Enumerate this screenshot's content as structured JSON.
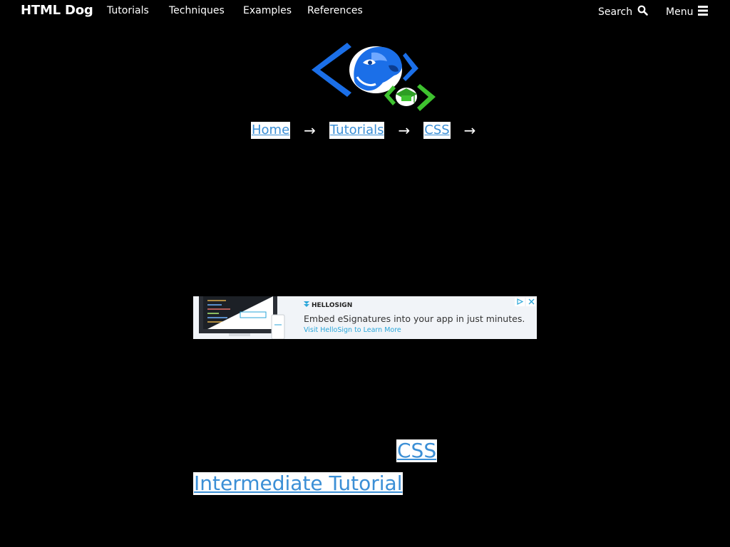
{
  "header": {
    "brand": "HTML Dog",
    "nav": [
      "Tutorials",
      "Techniques",
      "Examples",
      "References"
    ],
    "search_label": "Search",
    "menu_label": "Menu",
    "search_icon": "search-icon",
    "menu_icon": "hamburger-icon"
  },
  "breadcrumb": {
    "items": [
      "Home",
      "Tutorials",
      "CSS"
    ],
    "separator": "→"
  },
  "ad": {
    "brand": "HELLOSIGN",
    "headline": "Embed eSignatures into your app in just minutes.",
    "cta": "Visit HelloSign to Learn More"
  },
  "main": {
    "link_primary": "CSS",
    "link_secondary": "Intermediate Tutorial"
  },
  "colors": {
    "background": "#000000",
    "link": "#3b8fd6",
    "logo_blue": "#1b6fe8",
    "logo_green": "#3ec22f"
  }
}
